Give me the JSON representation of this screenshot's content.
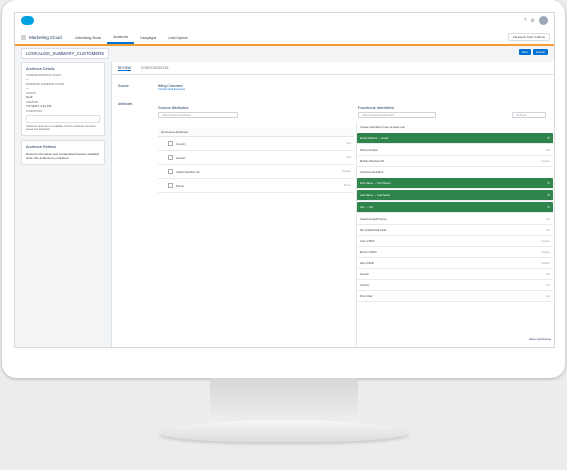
{
  "header": {
    "app_name": "Marketing Cloud",
    "search_placeholder": "Advertising Studio",
    "nav_items": [
      "Audiences",
      "Campaigns",
      "Lead Capture"
    ],
    "user_menu": "Facebook Tech Cuffinus"
  },
  "record": {
    "name": "LOOKALIKE_SUMMARY_CUSTOMERS",
    "buttons": [
      "Save",
      "Activate"
    ]
  },
  "left": {
    "details_title": "Audience Details",
    "fields": [
      {
        "label": "SOURCE AUDIENCE COUNT",
        "value": "—"
      },
      {
        "label": "FACEBOOK AUDIENCE COUNT",
        "value": "—"
      },
      {
        "label": "STATUS",
        "value": "Draft"
      },
      {
        "label": "CREATED",
        "value": "7/17/2017 4:12 PM"
      },
      {
        "label": "LOOKUP KEY",
        "value": ""
      }
    ],
    "details_note": "Audience sizes are not available until the audience has been saved and uploaded.",
    "refresh_title": "Audience Refresh",
    "refresh_note": "Refresh information and extrapolated buckets available when this audience is published."
  },
  "main": {
    "tabs": [
      "REVIEW",
      "CONFIGURATION"
    ],
    "source_label": "Source",
    "source_name": "Billing Customers",
    "source_sub": "Contact Data Extension",
    "attribute_label": "Attributes",
    "source_col_title": "Source Attributes",
    "source_search_placeholder": "Search Source Attributes",
    "source_list_header": "All Source Attributes",
    "source_rows": [
      {
        "name": "Country",
        "type": "Text"
      },
      {
        "name": "Gender",
        "type": "Text"
      },
      {
        "name": "Article Identifier (2)",
        "type": "Number"
      },
      {
        "name": "Phone",
        "type": "Phone"
      }
    ],
    "dest_col_title": "Facebook Identifiers",
    "dest_search_placeholder": "Search Facebook Identifiers",
    "dest_filter": "All Types",
    "dest_note": "Unique Identifiers (map at least one)",
    "dest_rows_required": [
      {
        "name": "Email Address → Email",
        "type": "✕",
        "mapped": true
      },
      {
        "name": "Phone Number",
        "type": "Text",
        "mapped": false
      },
      {
        "name": "Mobile Advertiser ID",
        "type": "Number",
        "mapped": false
      }
    ],
    "optional_label": "Optional Identifiers",
    "dest_rows_optional": [
      {
        "name": "First Name → First Name",
        "type": "✕",
        "mapped": true
      },
      {
        "name": "Last Name → Last Name",
        "type": "✕",
        "mapped": true
      },
      {
        "name": "City → City",
        "type": "✕",
        "mapped": true
      },
      {
        "name": "State/County/Province",
        "type": "Text",
        "mapped": false
      },
      {
        "name": "Zip Code/Postal Code",
        "type": "Text",
        "mapped": false
      },
      {
        "name": "Year of Birth",
        "type": "Number",
        "mapped": false
      },
      {
        "name": "Month of Birth",
        "type": "Number",
        "mapped": false
      },
      {
        "name": "Day of Birth",
        "type": "Number",
        "mapped": false
      },
      {
        "name": "Gender",
        "type": "Text",
        "mapped": false
      },
      {
        "name": "Country",
        "type": "Text",
        "mapped": false
      },
      {
        "name": "First Initial",
        "type": "Text",
        "mapped": false
      }
    ],
    "footer_link": "Save Continue ▸"
  }
}
